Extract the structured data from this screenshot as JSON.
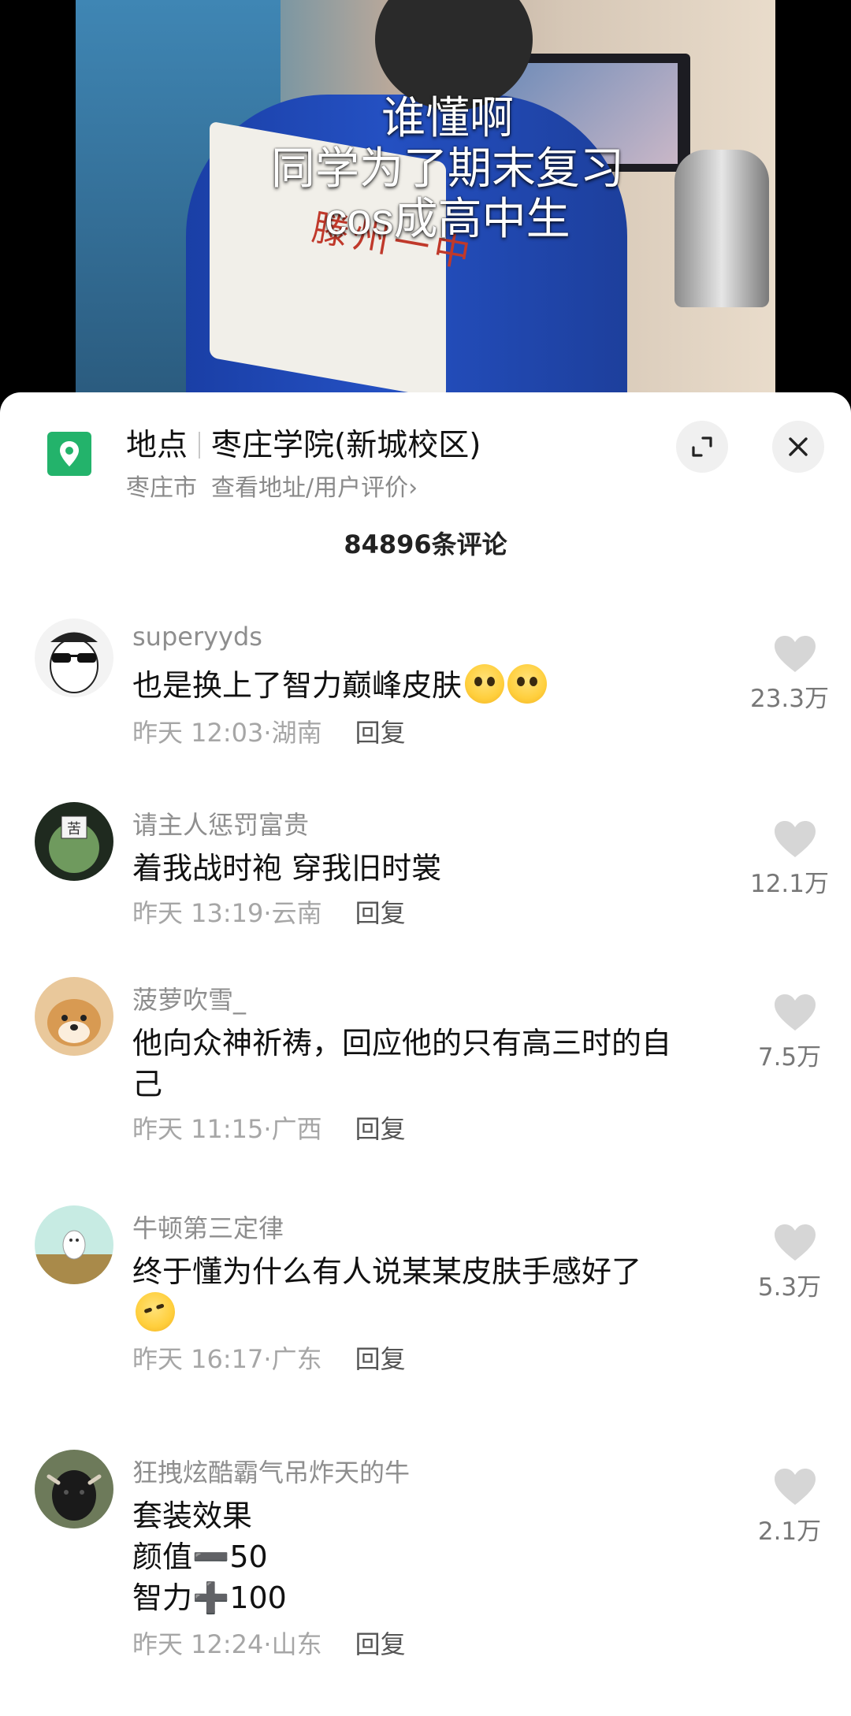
{
  "video": {
    "caption_lines": [
      "谁懂啊",
      "同学为了期末复习",
      "cos成高中生"
    ],
    "school_text": "滕州一中"
  },
  "location": {
    "label": "地点",
    "name": "枣庄学院(新城校区)",
    "city": "枣庄市",
    "link": "查看地址/用户评价",
    "link_chevron": "›"
  },
  "comment_count": "84896条评论",
  "comments": [
    {
      "name": "superyyds",
      "lines": [
        "也是换上了智力巅峰皮肤"
      ],
      "emojis": [
        "pleading-face",
        "pleading-face"
      ],
      "time": "昨天 12:03",
      "region": "湖南",
      "reply": "回复",
      "likes": "23.3万"
    },
    {
      "name": "请主人惩罚富贵",
      "lines": [
        "着我战时袍 穿我旧时裳"
      ],
      "time": "昨天 13:19",
      "region": "云南",
      "reply": "回复",
      "likes": "12.1万"
    },
    {
      "name": "菠萝吹雪_",
      "lines": [
        "他向众神祈祷，回应他的只有高三时的自",
        "己"
      ],
      "time": "昨天 11:15",
      "region": "广西",
      "reply": "回复",
      "likes": "7.5万"
    },
    {
      "name": "牛顿第三定律",
      "lines": [
        "终于懂为什么有人说某某皮肤手感好了"
      ],
      "emojis": [
        "rolling-laugh-face"
      ],
      "time": "昨天 16:17",
      "region": "广东",
      "reply": "回复",
      "likes": "5.3万"
    },
    {
      "name": "狂拽炫酷霸气吊炸天的牛",
      "lines": [
        "套装效果",
        "颜值➖50",
        "智力➕100"
      ],
      "time": "昨天 12:24",
      "region": "山东",
      "reply": "回复",
      "likes": "2.1万"
    }
  ],
  "meta_separator": "·",
  "colors": {
    "location_icon_bg": "#23b36b",
    "like_icon": "#d6d6d6"
  },
  "icons": [
    "location-pin-icon",
    "expand-icon",
    "close-icon",
    "heart-icon"
  ]
}
